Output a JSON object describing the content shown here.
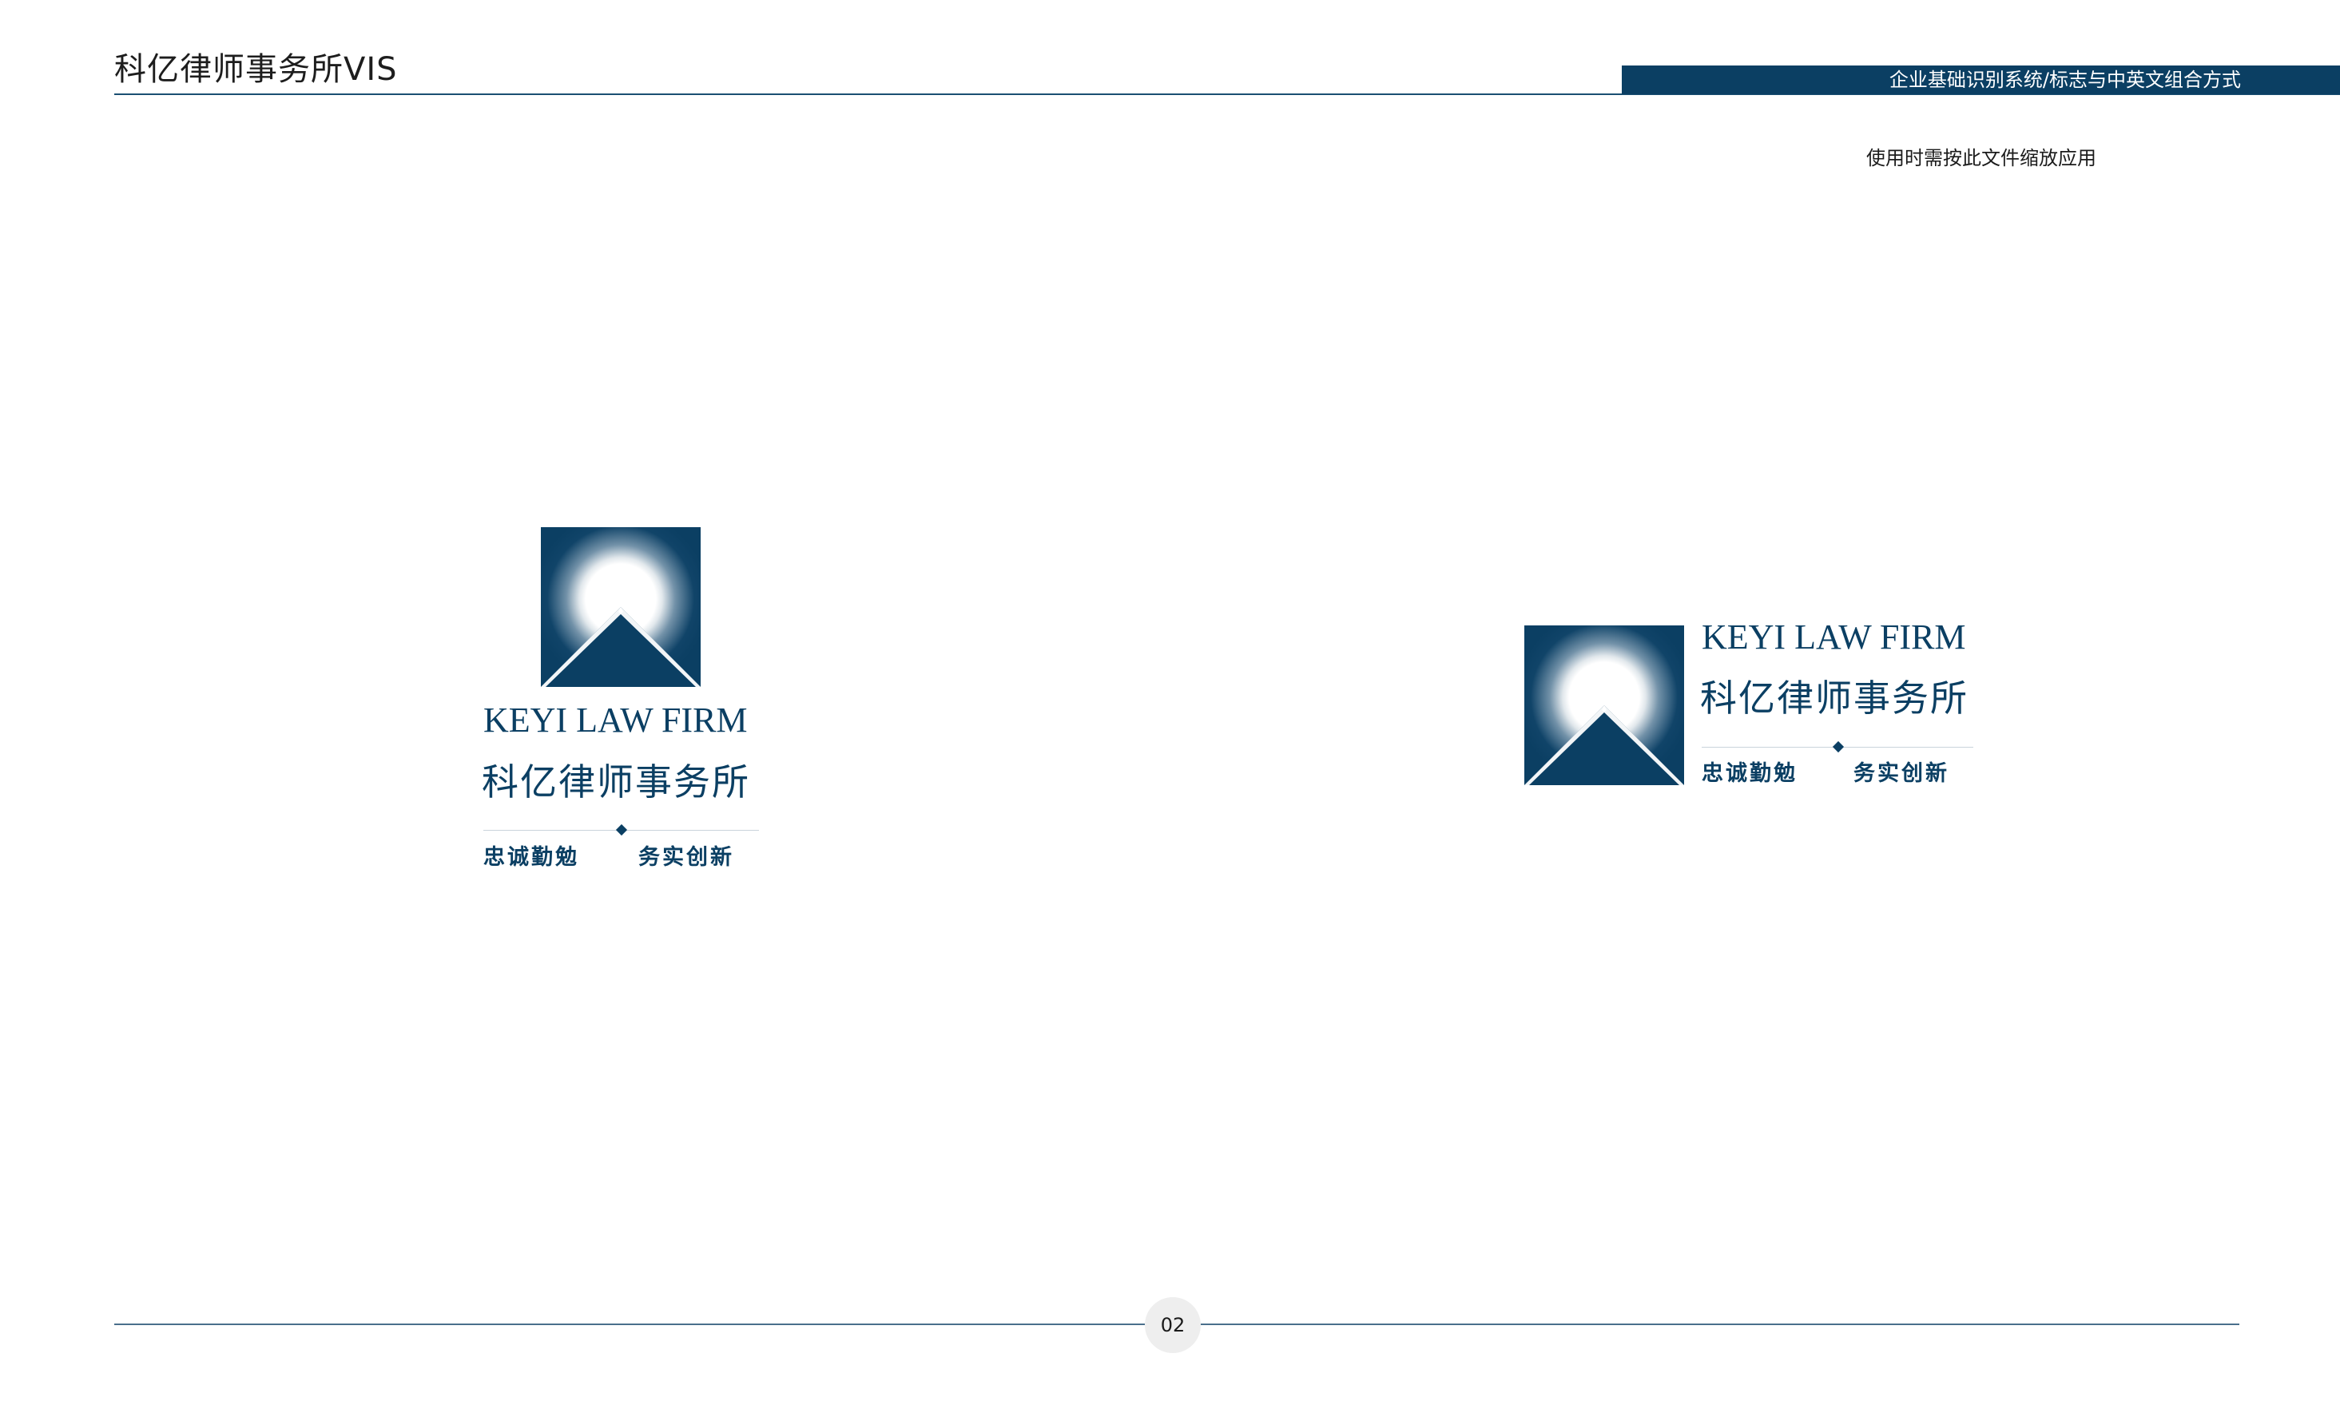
{
  "header": {
    "title": "科亿律师事务所VIS",
    "section_label": "企业基础识别系统/标志与中英文组合方式",
    "usage_note": "使用时需按此文件缩放应用"
  },
  "logo": {
    "english_name": "KEYI LAW FIRM",
    "chinese_name": "科亿律师事务所",
    "slogan_left": "忠诚勤勉",
    "slogan_right": "务实创新",
    "emblem_icon": "mountain-sunrise-icon",
    "brand_color": "#0b3f63"
  },
  "layouts": {
    "vertical": "vertical-logo-lockup",
    "horizontal": "horizontal-logo-lockup"
  },
  "footer": {
    "page_number": "02"
  },
  "colors": {
    "brand_navy": "#0b3f63",
    "header_text": "#1d1d1d",
    "page_badge_bg": "#eeeeee"
  }
}
